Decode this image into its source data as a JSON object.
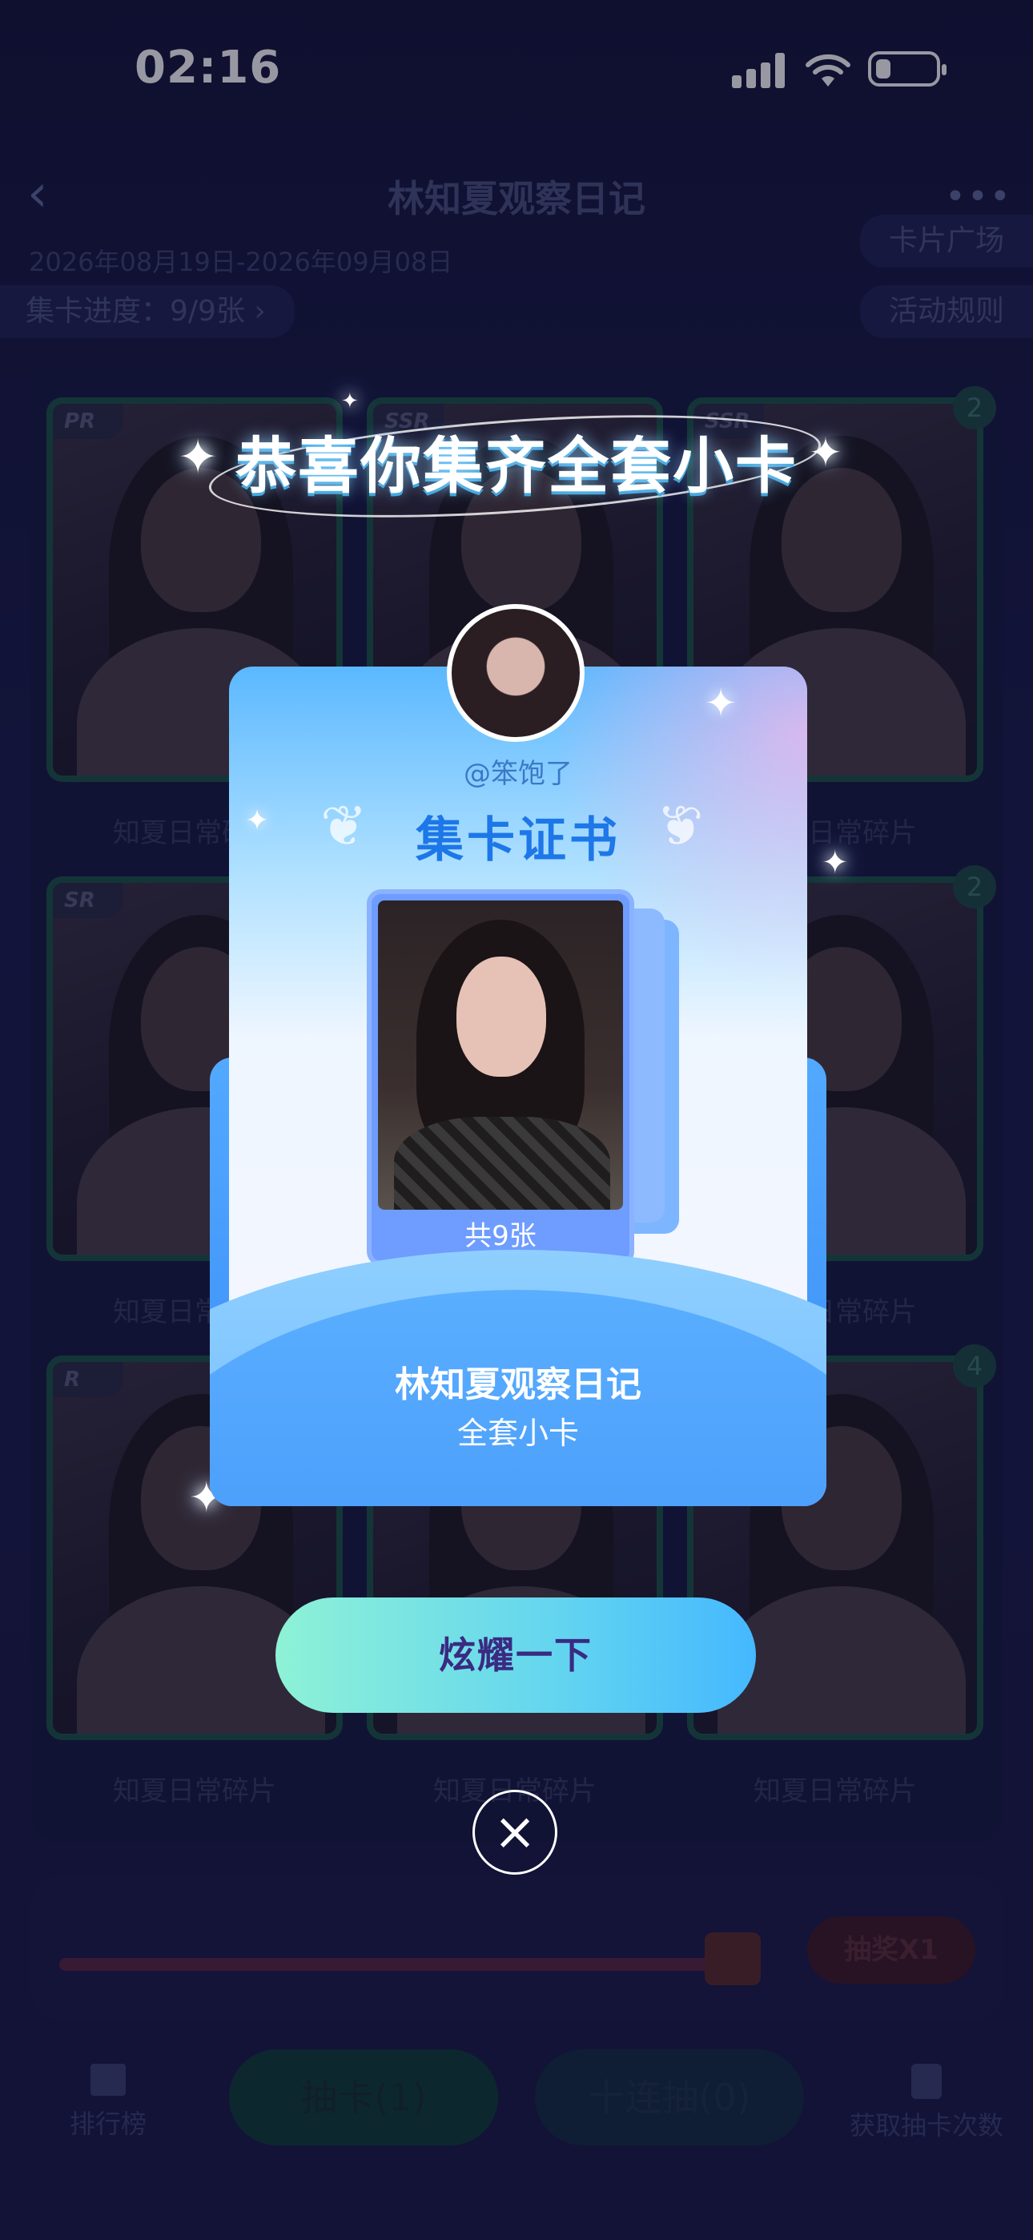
{
  "status_bar": {
    "time": "02:16"
  },
  "header": {
    "title": "林知夏观察日记",
    "date_range": "2026年08月19日-2026年09月08日",
    "progress": "集卡进度：9/9张 ›",
    "card_plaza": "卡片广场",
    "activity_rules": "活动规则",
    "more": "•••"
  },
  "grid": {
    "cards": [
      {
        "rarity": "PR",
        "label": "知夏日常碎片",
        "count": ""
      },
      {
        "rarity": "SSR",
        "label": "知夏日常碎片",
        "count": ""
      },
      {
        "rarity": "SSR",
        "label": "知夏日常碎片",
        "count": "2"
      },
      {
        "rarity": "SR",
        "label": "知夏日常碎片",
        "count": ""
      },
      {
        "rarity": "",
        "label": "知夏日常碎片",
        "count": ""
      },
      {
        "rarity": "",
        "label": "知夏日常碎片",
        "count": "2"
      },
      {
        "rarity": "R",
        "label": "知夏日常碎片",
        "count": ""
      },
      {
        "rarity": "",
        "label": "知夏日常碎片",
        "count": ""
      },
      {
        "rarity": "",
        "label": "知夏日常碎片",
        "count": "4"
      }
    ]
  },
  "bottom": {
    "progress_fraction": 0.98,
    "lottery_button": "抽奖X1",
    "ranking": "排行榜",
    "draw_button": "抽卡(1)",
    "ten_draw_button": "十连抽(0)",
    "get_draws": "获取抽卡次数"
  },
  "modal": {
    "congrats_title": "恭喜你集齐全套小卡",
    "username": "@笨饱了",
    "certificate_heading": "集卡证书",
    "total_count": "共9张",
    "collection_name": "林知夏观察日记",
    "collection_subtitle": "全套小卡",
    "show_off_button": "炫耀一下",
    "close_icon": "close-icon"
  },
  "colors": {
    "accent": "#45b8ff",
    "certificate_heading": "#1d77e8",
    "show_off_text": "#3a2a82"
  }
}
